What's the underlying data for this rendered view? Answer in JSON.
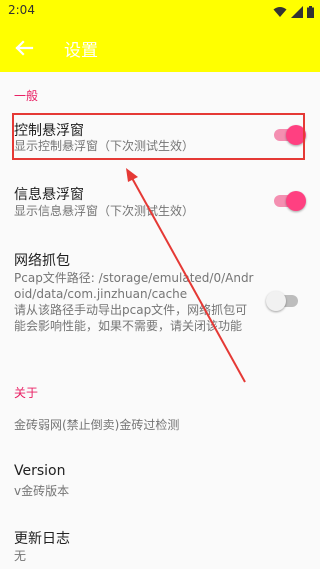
{
  "status_bar": {
    "time": "2:04"
  },
  "app_bar": {
    "title": "设置",
    "icon": "back-arrow-icon"
  },
  "sections": {
    "general": {
      "header": "一般",
      "control_float": {
        "title": "控制悬浮窗",
        "summary": "显示控制悬浮窗（下次测试生效）",
        "enabled": true
      },
      "info_float": {
        "title": "信息悬浮窗",
        "summary": "显示信息悬浮窗（下次测试生效）",
        "enabled": true
      },
      "capture": {
        "title": "网络抓包",
        "summary": "Pcap文件路径: /storage/emulated/0/Android/data/com.jinzhuan/cache\n请从该路径手动导出pcap文件，网络抓包可能会影响性能，如果不需要，请关闭该功能",
        "enabled": false
      }
    },
    "about": {
      "header": "关于",
      "description": "金砖弱网(禁止倒卖)金砖过检测",
      "version": {
        "title": "Version",
        "summary": "v金砖版本"
      },
      "changelog": {
        "title": "更新日志",
        "summary": "无"
      }
    }
  },
  "colors": {
    "app_bar": "#ffff00",
    "accent": "#ff4081",
    "category": "#e91e63",
    "annotation": "#e53935"
  }
}
